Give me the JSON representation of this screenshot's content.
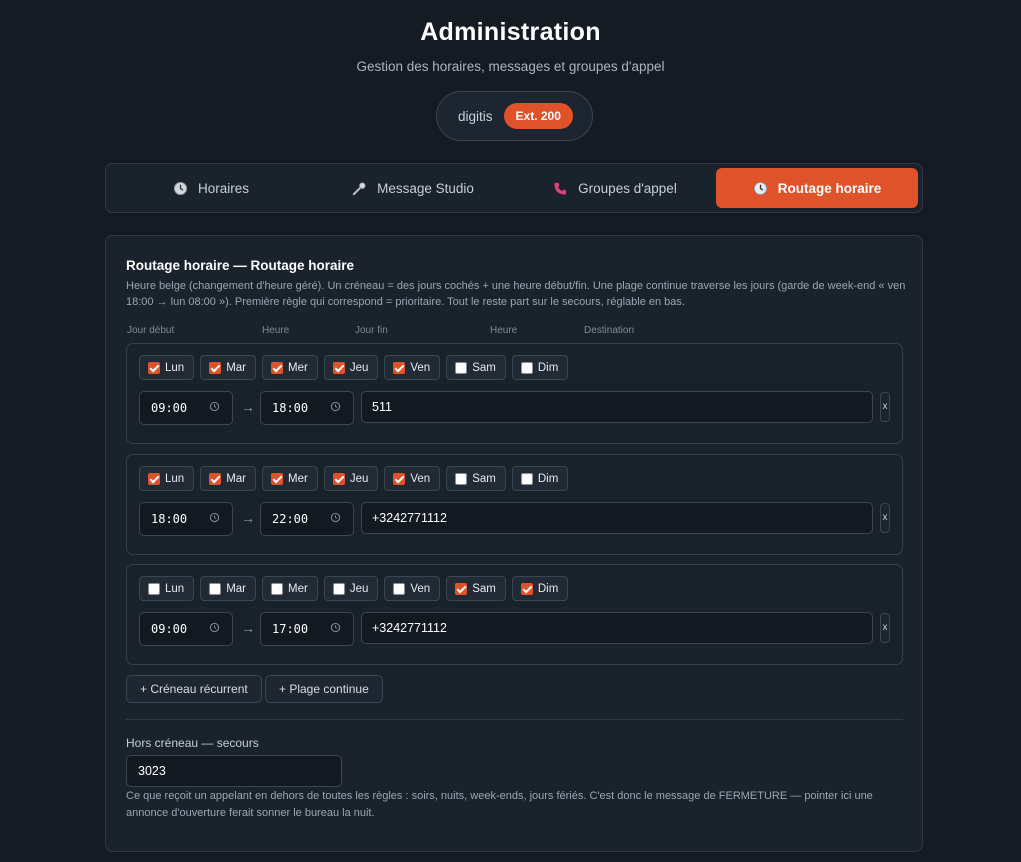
{
  "header": {
    "title": "Administration",
    "subtitle": "Gestion des horaires, messages et groupes d'appel",
    "user": "digitis",
    "extension": "Ext. 200"
  },
  "tabs": [
    {
      "label": "Horaires",
      "icon": "clock-icon"
    },
    {
      "label": "Message Studio",
      "icon": "microphone-icon"
    },
    {
      "label": "Groupes d'appel",
      "icon": "phone-icon"
    },
    {
      "label": "Routage horaire",
      "icon": "clock-icon",
      "active": true
    }
  ],
  "colors": {
    "accent": "#e0532a",
    "background": "#151b22",
    "panel": "#1a222c"
  },
  "routing": {
    "title": "Routage horaire — Routage horaire",
    "description": "Heure belge (changement d'heure géré). Un créneau = des jours cochés + une heure début/fin. Une plage continue traverse les jours (garde de week-end « ven 18:00 → lun 08:00 »). Première règle qui correspond = prioritaire. Tout le reste part sur le secours, réglable en bas.",
    "columns": {
      "start_day": "Jour début",
      "start_hour": "Heure",
      "end_day": "Jour fin",
      "end_hour": "Heure",
      "destination": "Destination"
    },
    "rules": [
      {
        "days": [
          {
            "label": "Lun",
            "checked": true
          },
          {
            "label": "Mar",
            "checked": true
          },
          {
            "label": "Mer",
            "checked": true
          },
          {
            "label": "Jeu",
            "checked": true
          },
          {
            "label": "Ven",
            "checked": true
          },
          {
            "label": "Sam",
            "checked": false
          },
          {
            "label": "Dim",
            "checked": false
          }
        ],
        "start": "09:00",
        "end": "18:00",
        "destination": "511",
        "delete_label": "x"
      },
      {
        "days": [
          {
            "label": "Lun",
            "checked": true
          },
          {
            "label": "Mar",
            "checked": true
          },
          {
            "label": "Mer",
            "checked": true
          },
          {
            "label": "Jeu",
            "checked": true
          },
          {
            "label": "Ven",
            "checked": true
          },
          {
            "label": "Sam",
            "checked": false
          },
          {
            "label": "Dim",
            "checked": false
          }
        ],
        "start": "18:00",
        "end": "22:00",
        "destination": "+3242771112",
        "delete_label": "x"
      },
      {
        "days": [
          {
            "label": "Lun",
            "checked": false
          },
          {
            "label": "Mar",
            "checked": false
          },
          {
            "label": "Mer",
            "checked": false
          },
          {
            "label": "Jeu",
            "checked": false
          },
          {
            "label": "Ven",
            "checked": false
          },
          {
            "label": "Sam",
            "checked": true
          },
          {
            "label": "Dim",
            "checked": true
          }
        ],
        "start": "09:00",
        "end": "17:00",
        "destination": "+3242771112",
        "delete_label": "x"
      }
    ],
    "arrow": "→",
    "add_recurring": "+ Créneau récurrent",
    "add_continuous": "+ Plage continue",
    "fallback": {
      "label": "Hors créneau — secours",
      "value": "3023",
      "help": "Ce que reçoit un appelant en dehors de toutes les règles : soirs, nuits, week-ends, jours fériés. C'est donc le message de FERMETURE — pointer ici une annonce d'ouverture ferait sonner le bureau la nuit."
    }
  }
}
